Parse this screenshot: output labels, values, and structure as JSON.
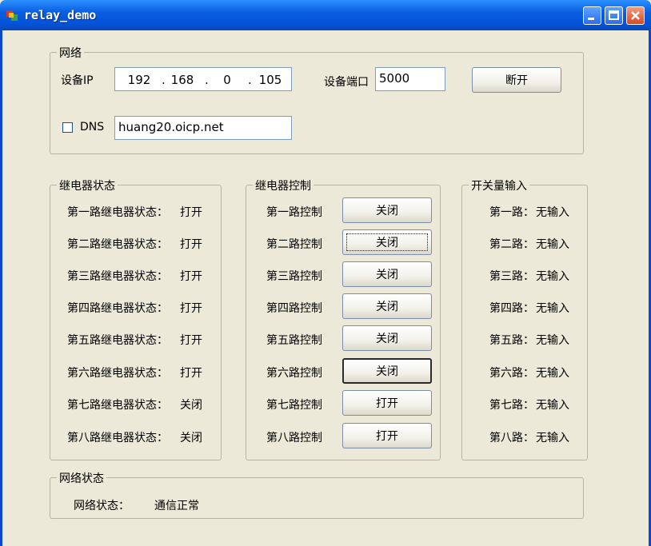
{
  "window": {
    "title": "relay_demo"
  },
  "network": {
    "group_label": "网络",
    "ip_label": "设备IP",
    "ip": [
      "192",
      "168",
      "0",
      "105"
    ],
    "port_label": "设备端口",
    "port_value": "5000",
    "disconnect_label": "断开",
    "dns_label": "DNS",
    "dns_value": "huang20.oicp.net"
  },
  "relay_status": {
    "group_label": "继电器状态",
    "items": [
      {
        "label": "第一路继电器状态：",
        "value": "打开"
      },
      {
        "label": "第二路继电器状态：",
        "value": "打开"
      },
      {
        "label": "第三路继电器状态：",
        "value": "打开"
      },
      {
        "label": "第四路继电器状态：",
        "value": "打开"
      },
      {
        "label": "第五路继电器状态：",
        "value": "打开"
      },
      {
        "label": "第六路继电器状态：",
        "value": "打开"
      },
      {
        "label": "第七路继电器状态：",
        "value": "关闭"
      },
      {
        "label": "第八路继电器状态：",
        "value": "关闭"
      }
    ]
  },
  "relay_control": {
    "group_label": "继电器控制",
    "items": [
      {
        "label": "第一路控制",
        "button": "关闭"
      },
      {
        "label": "第二路控制",
        "button": "关闭"
      },
      {
        "label": "第三路控制",
        "button": "关闭"
      },
      {
        "label": "第四路控制",
        "button": "关闭"
      },
      {
        "label": "第五路控制",
        "button": "关闭"
      },
      {
        "label": "第六路控制",
        "button": "关闭"
      },
      {
        "label": "第七路控制",
        "button": "打开"
      },
      {
        "label": "第八路控制",
        "button": "打开"
      }
    ]
  },
  "switch_input": {
    "group_label": "开关量输入",
    "items": [
      {
        "label": "第一路：",
        "value": "无输入"
      },
      {
        "label": "第二路：",
        "value": "无输入"
      },
      {
        "label": "第三路：",
        "value": "无输入"
      },
      {
        "label": "第四路：",
        "value": "无输入"
      },
      {
        "label": "第五路：",
        "value": "无输入"
      },
      {
        "label": "第六路：",
        "value": "无输入"
      },
      {
        "label": "第七路：",
        "value": "无输入"
      },
      {
        "label": "第八路：",
        "value": "无输入"
      }
    ]
  },
  "net_status": {
    "group_label": "网络状态",
    "label": "网络状态：",
    "value": "通信正常"
  }
}
